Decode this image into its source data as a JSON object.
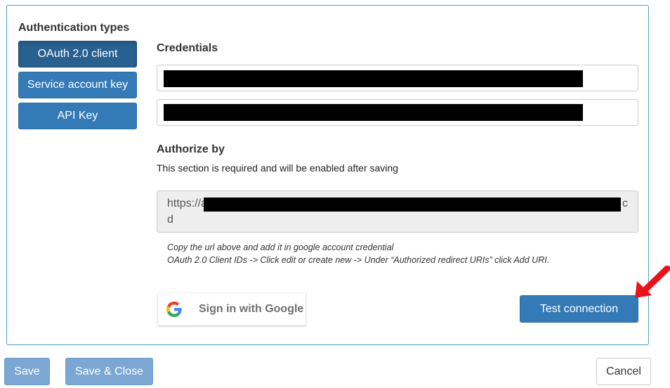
{
  "auth": {
    "title": "Authentication types",
    "types": [
      "OAuth 2.0 client",
      "Service account key",
      "API Key"
    ],
    "active_index": 0
  },
  "credentials": {
    "title": "Credentials"
  },
  "authorize": {
    "title": "Authorize by",
    "helper": "This section is required and will be enabled after saving",
    "url_prefix": "https://a",
    "url_suffix_line1": "c",
    "url_line2": "d",
    "note_line1": "Copy the url above and add it in google account credential",
    "note_line2": "OAuth 2.0 Client IDs -> Click edit or create new -> Under “Authorized redirect URIs” click Add URI.",
    "google_button": "Sign in with Google",
    "test_button": "Test connection"
  },
  "footer": {
    "save": "Save",
    "save_close": "Save & Close",
    "cancel": "Cancel"
  },
  "colors": {
    "primary": "#337ab7",
    "primary_active": "#286090",
    "panel_border": "#4aa0c6",
    "annotation_arrow": "#e8141b"
  }
}
